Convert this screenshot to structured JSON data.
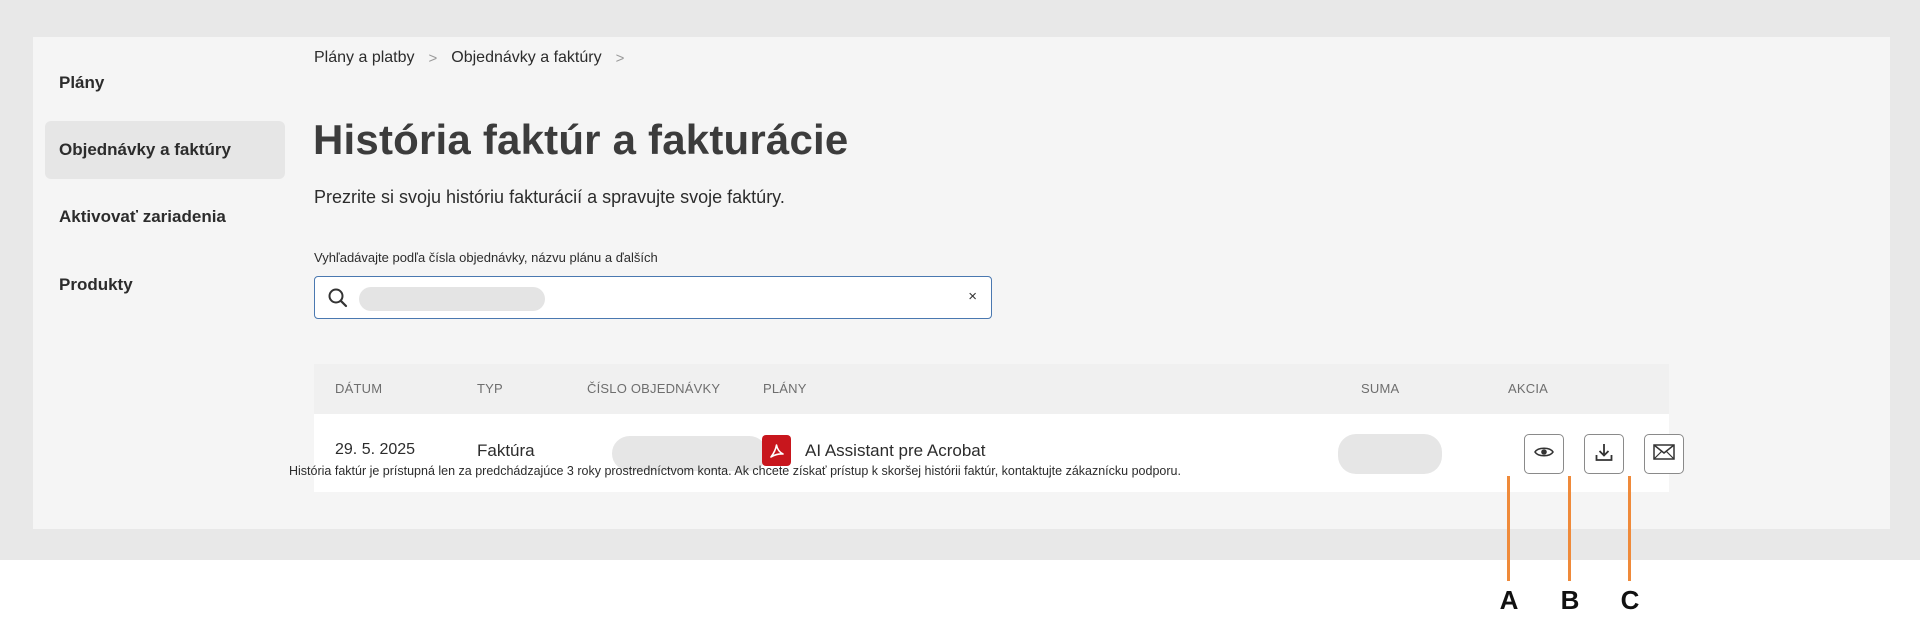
{
  "sidebar": {
    "items": [
      {
        "label": "Plány",
        "active": false
      },
      {
        "label": "Objednávky a faktúry",
        "active": true
      },
      {
        "label": "Aktivovať zariadenia",
        "active": false
      },
      {
        "label": "Produkty",
        "active": false
      }
    ]
  },
  "breadcrumb": {
    "items": [
      "Plány a platby",
      "Objednávky a faktúry"
    ],
    "separator": ">"
  },
  "page": {
    "title": "História faktúr a fakturácie",
    "subtitle": "Prezrite si svoju históriu fakturácií a spravujte svoje faktúry."
  },
  "search": {
    "label": "Vyhľadávajte podľa čísla objednávky, názvu plánu a ďalších",
    "value": "",
    "clear_glyph": "×"
  },
  "table": {
    "headers": [
      "DÁTUM",
      "TYP",
      "ČÍSLO OBJEDNÁVKY",
      "PLÁNY",
      "SUMA",
      "AKCIA"
    ],
    "rows": [
      {
        "date": "29. 5. 2025",
        "type": "Faktúra",
        "order_number": "",
        "plan": "AI Assistant pre Acrobat",
        "plan_icon": "acrobat-pdf-icon",
        "amount": "",
        "actions": [
          "view-eye-icon",
          "download-icon",
          "email-envelope-icon"
        ]
      }
    ]
  },
  "footnote": "História faktúr je prístupná len za predchádzajúce 3 roky prostredníctvom konta. Ak chcete získať prístup k skoršej histórii faktúr, kontaktujte zákaznícku podporu.",
  "annotations": {
    "labels": [
      "A",
      "B",
      "C"
    ],
    "color": "#ef8a3a"
  },
  "colors": {
    "acrobat_red": "#c8161d",
    "search_border": "#4a78b0"
  }
}
